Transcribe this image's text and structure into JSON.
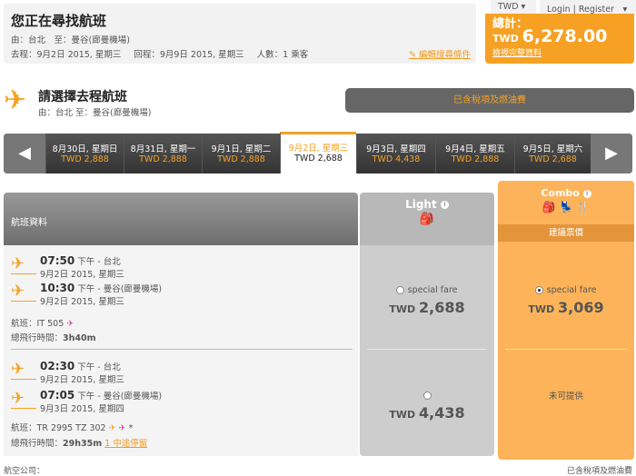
{
  "header": {
    "title": "您正在尋找航班",
    "route": "由：台北　至：曼谷(廊曼機場)",
    "depart": "去程：9月2日 2015, 星期三",
    "return": "回程：9月9日 2015, 星期三",
    "pax": "人數：1 乘客",
    "edit": "編輯搜尋條件"
  },
  "topbar": {
    "currency": "TWD ▾",
    "login": "Login | Register　▾"
  },
  "total": {
    "label": "總計：",
    "currency": "TWD",
    "amount": "6,278.00",
    "link": "檢視完整資料"
  },
  "select": {
    "title": "請選擇去程航班",
    "route": "由：台北 至：曼谷(廊曼機場)",
    "tax_note": "已含稅項及燃油費"
  },
  "dates": [
    {
      "label": "8月30日, 星期日",
      "price": "TWD 2,888"
    },
    {
      "label": "8月31日, 星期一",
      "price": "TWD 2,888"
    },
    {
      "label": "9月1日, 星期二",
      "price": "TWD 2,888"
    },
    {
      "label": "9月2日, 星期三",
      "price": "TWD 2,688"
    },
    {
      "label": "9月3日, 星期四",
      "price": "TWD 4,438"
    },
    {
      "label": "9月4日, 星期五",
      "price": "TWD 2,888"
    },
    {
      "label": "9月5日, 星期六",
      "price": "TWD 2,688"
    }
  ],
  "columns": {
    "info": "航班資料",
    "light": "Light",
    "combo": "Combo",
    "recommended": "建議票價"
  },
  "flights": [
    {
      "dep_time": "07:50",
      "dep_info": "下午 - 台北",
      "dep_date": "9月2日 2015, 星期三",
      "arr_time": "10:30",
      "arr_info": "下午 - 曼谷(廊曼機場)",
      "arr_date": "9月2日 2015, 星期三",
      "flight_label": "航班：",
      "flight_no": "IT 505",
      "duration_label": "總飛行時間：",
      "duration": "3h40m",
      "stops": "",
      "light": {
        "fare": "special fare",
        "currency": "TWD",
        "price": "2,688",
        "selected": false
      },
      "combo": {
        "fare": "special fare",
        "currency": "TWD",
        "price": "3,069",
        "selected": true
      }
    },
    {
      "dep_time": "02:30",
      "dep_info": "下午 - 台北",
      "dep_date": "9月2日 2015, 星期三",
      "arr_time": "07:05",
      "arr_info": "下午 - 曼谷(廊曼機場)",
      "arr_date": "9月3日 2015, 星期四",
      "flight_label": "航班：",
      "flight_no": "TR 2995 TZ 302",
      "duration_label": "總飛行時間：",
      "duration": "29h35m",
      "stops": "1 中途停留",
      "light": {
        "fare": "",
        "currency": "TWD",
        "price": "4,438",
        "selected": false
      },
      "combo": {
        "unavailable": "未可提供"
      }
    }
  ],
  "footer": {
    "airline": "航空公司：",
    "tax": "已含稅項及燃油費"
  }
}
